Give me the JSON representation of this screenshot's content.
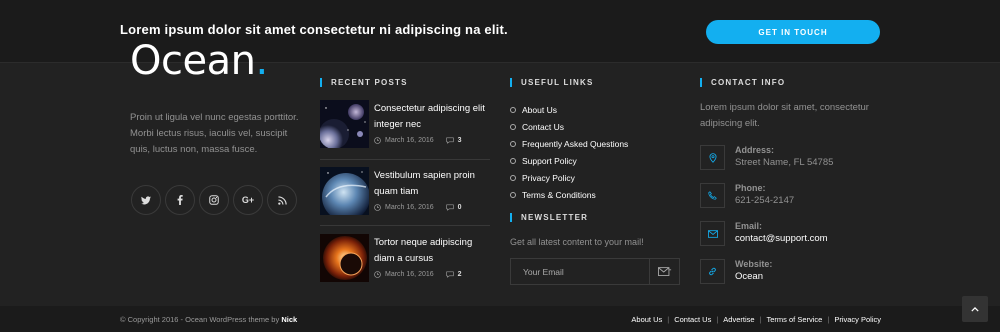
{
  "cta": {
    "text": "Lorem ipsum dolor sit amet consectetur ni adipiscing na elit.",
    "button": "GET IN TOUCH"
  },
  "brand": {
    "name": "Ocean",
    "dot": ".",
    "about": "Proin ut ligula vel nunc egestas porttitor. Morbi lectus risus, iaculis vel, suscipit quis, luctus non, massa fusce.",
    "accent": "#13aff0"
  },
  "socials": [
    "twitter-icon",
    "facebook-icon",
    "instagram-icon",
    "google-plus-icon",
    "rss-icon"
  ],
  "recent_posts": {
    "title": "RECENT POSTS",
    "items": [
      {
        "title": "Consectetur adipiscing elit integer nec",
        "date": "March 16, 2016",
        "comments": "3"
      },
      {
        "title": "Vestibulum sapien proin quam tiam",
        "date": "March 16, 2016",
        "comments": "0"
      },
      {
        "title": "Tortor neque adipiscing diam a cursus",
        "date": "March 16, 2016",
        "comments": "2"
      }
    ]
  },
  "useful_links": {
    "title": "USEFUL LINKS",
    "items": [
      "About Us",
      "Contact Us",
      "Frequently Asked Questions",
      "Support Policy",
      "Privacy Policy",
      "Terms & Conditions"
    ]
  },
  "newsletter": {
    "title": "NEWSLETTER",
    "text": "Get all latest content to your mail!",
    "placeholder": "Your Email"
  },
  "contact": {
    "title": "CONTACT INFO",
    "intro": "Lorem ipsum dolor sit amet, consectetur adipiscing elit.",
    "address_label": "Address:",
    "address": "Street Name, FL 54785",
    "phone_label": "Phone:",
    "phone": "621-254-2147",
    "email_label": "Email:",
    "email": "contact@support.com",
    "website_label": "Website:",
    "website": "Ocean"
  },
  "bottom": {
    "copyright": "© Copyright 2016 - Ocean WordPress theme by",
    "author": "Nick",
    "links": [
      "About Us",
      "Contact Us",
      "Advertise",
      "Terms of Service",
      "Privacy Policy"
    ]
  }
}
